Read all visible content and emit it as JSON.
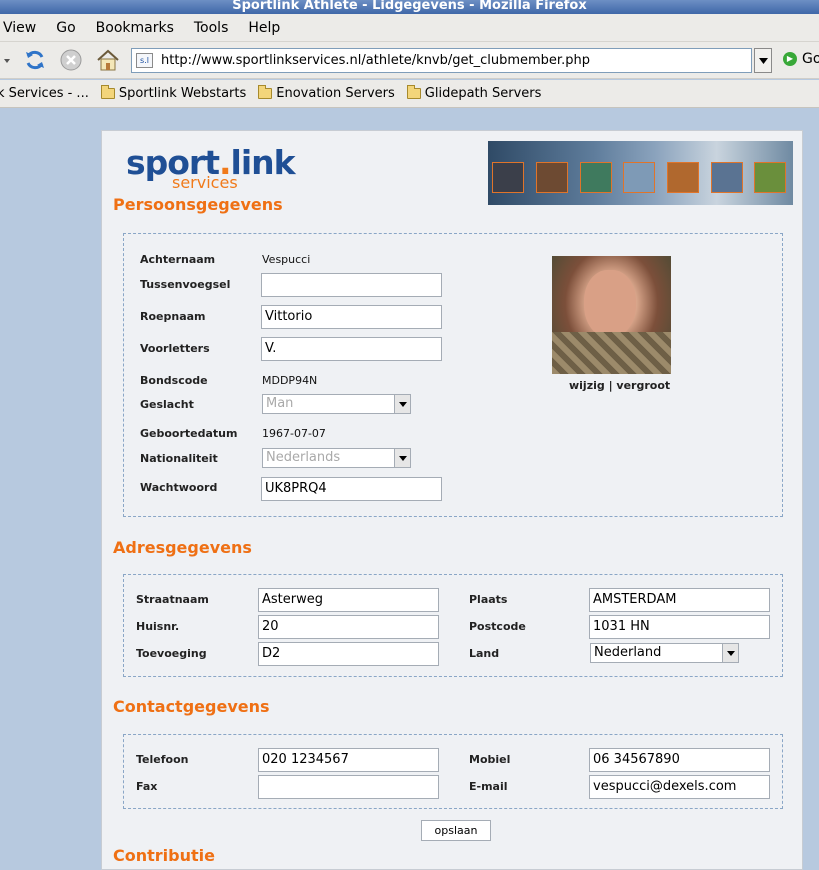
{
  "window": {
    "title": "Sportlink Athlete - Lidgegevens - Mozilla Firefox"
  },
  "menu": {
    "items": [
      "View",
      "Go",
      "Bookmarks",
      "Tools",
      "Help"
    ]
  },
  "toolbar": {
    "url": "http://www.sportlinkservices.nl/athlete/knvb/get_clubmember.php",
    "site_icon_text": "s.l",
    "go_label": "Go"
  },
  "bookmarks": {
    "items": [
      "k Services - ...",
      "Sportlink Webstarts",
      "Enovation Servers",
      "Glidepath Servers"
    ]
  },
  "logo": {
    "brand_main": "sport",
    "brand_dot": ".",
    "brand_link": "link",
    "brand_sub": "services"
  },
  "colors": {
    "accent": "#ef7014",
    "brand_blue": "#1f4f95",
    "page_bg": "#b7c9df"
  },
  "persoonsgegevens": {
    "title": "Persoonsgegevens",
    "achternaam_label": "Achternaam",
    "achternaam": "Vespucci",
    "tussenvoegsel_label": "Tussenvoegsel",
    "tussenvoegsel": "",
    "roepnaam_label": "Roepnaam",
    "roepnaam": "Vittorio",
    "voorletters_label": "Voorletters",
    "voorletters": "V.",
    "bondscode_label": "Bondscode",
    "bondscode": "MDDP94N",
    "geslacht_label": "Geslacht",
    "geslacht": "Man",
    "geboortedatum_label": "Geboortedatum",
    "geboortedatum": "1967-07-07",
    "nationaliteit_label": "Nationaliteit",
    "nationaliteit": "Nederlands",
    "wachtwoord_label": "Wachtwoord",
    "wachtwoord": "UK8PRQ4",
    "photo_link": "wijzig | vergroot"
  },
  "adresgegevens": {
    "title": "Adresgegevens",
    "straatnaam_label": "Straatnaam",
    "straatnaam": "Asterweg",
    "huisnr_label": "Huisnr.",
    "huisnr": "20",
    "toevoeging_label": "Toevoeging",
    "toevoeging": "D2",
    "plaats_label": "Plaats",
    "plaats": "AMSTERDAM",
    "postcode_label": "Postcode",
    "postcode": "1031 HN",
    "land_label": "Land",
    "land": "Nederland"
  },
  "contactgegevens": {
    "title": "Contactgegevens",
    "telefoon_label": "Telefoon",
    "telefoon": "020 1234567",
    "fax_label": "Fax",
    "fax": "",
    "mobiel_label": "Mobiel",
    "mobiel": "06 34567890",
    "email_label": "E-mail",
    "email": "vespucci@dexels.com"
  },
  "actions": {
    "save_label": "opslaan"
  },
  "next_section_title": "Contributie"
}
